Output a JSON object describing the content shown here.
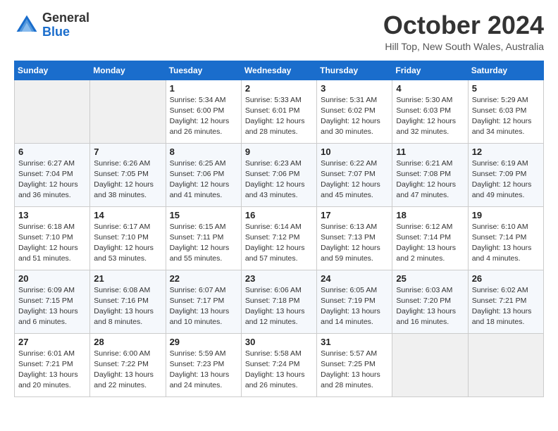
{
  "logo": {
    "general": "General",
    "blue": "Blue"
  },
  "title": "October 2024",
  "location": "Hill Top, New South Wales, Australia",
  "days_of_week": [
    "Sunday",
    "Monday",
    "Tuesday",
    "Wednesday",
    "Thursday",
    "Friday",
    "Saturday"
  ],
  "weeks": [
    [
      {
        "day": null
      },
      {
        "day": null
      },
      {
        "day": 1,
        "sunrise": "5:34 AM",
        "sunset": "6:00 PM",
        "daylight": "12 hours and 26 minutes"
      },
      {
        "day": 2,
        "sunrise": "5:33 AM",
        "sunset": "6:01 PM",
        "daylight": "12 hours and 28 minutes"
      },
      {
        "day": 3,
        "sunrise": "5:31 AM",
        "sunset": "6:02 PM",
        "daylight": "12 hours and 30 minutes"
      },
      {
        "day": 4,
        "sunrise": "5:30 AM",
        "sunset": "6:03 PM",
        "daylight": "12 hours and 32 minutes"
      },
      {
        "day": 5,
        "sunrise": "5:29 AM",
        "sunset": "6:03 PM",
        "daylight": "12 hours and 34 minutes"
      }
    ],
    [
      {
        "day": 6,
        "sunrise": "6:27 AM",
        "sunset": "7:04 PM",
        "daylight": "12 hours and 36 minutes"
      },
      {
        "day": 7,
        "sunrise": "6:26 AM",
        "sunset": "7:05 PM",
        "daylight": "12 hours and 38 minutes"
      },
      {
        "day": 8,
        "sunrise": "6:25 AM",
        "sunset": "7:06 PM",
        "daylight": "12 hours and 41 minutes"
      },
      {
        "day": 9,
        "sunrise": "6:23 AM",
        "sunset": "7:06 PM",
        "daylight": "12 hours and 43 minutes"
      },
      {
        "day": 10,
        "sunrise": "6:22 AM",
        "sunset": "7:07 PM",
        "daylight": "12 hours and 45 minutes"
      },
      {
        "day": 11,
        "sunrise": "6:21 AM",
        "sunset": "7:08 PM",
        "daylight": "12 hours and 47 minutes"
      },
      {
        "day": 12,
        "sunrise": "6:19 AM",
        "sunset": "7:09 PM",
        "daylight": "12 hours and 49 minutes"
      }
    ],
    [
      {
        "day": 13,
        "sunrise": "6:18 AM",
        "sunset": "7:10 PM",
        "daylight": "12 hours and 51 minutes"
      },
      {
        "day": 14,
        "sunrise": "6:17 AM",
        "sunset": "7:10 PM",
        "daylight": "12 hours and 53 minutes"
      },
      {
        "day": 15,
        "sunrise": "6:15 AM",
        "sunset": "7:11 PM",
        "daylight": "12 hours and 55 minutes"
      },
      {
        "day": 16,
        "sunrise": "6:14 AM",
        "sunset": "7:12 PM",
        "daylight": "12 hours and 57 minutes"
      },
      {
        "day": 17,
        "sunrise": "6:13 AM",
        "sunset": "7:13 PM",
        "daylight": "12 hours and 59 minutes"
      },
      {
        "day": 18,
        "sunrise": "6:12 AM",
        "sunset": "7:14 PM",
        "daylight": "13 hours and 2 minutes"
      },
      {
        "day": 19,
        "sunrise": "6:10 AM",
        "sunset": "7:14 PM",
        "daylight": "13 hours and 4 minutes"
      }
    ],
    [
      {
        "day": 20,
        "sunrise": "6:09 AM",
        "sunset": "7:15 PM",
        "daylight": "13 hours and 6 minutes"
      },
      {
        "day": 21,
        "sunrise": "6:08 AM",
        "sunset": "7:16 PM",
        "daylight": "13 hours and 8 minutes"
      },
      {
        "day": 22,
        "sunrise": "6:07 AM",
        "sunset": "7:17 PM",
        "daylight": "13 hours and 10 minutes"
      },
      {
        "day": 23,
        "sunrise": "6:06 AM",
        "sunset": "7:18 PM",
        "daylight": "13 hours and 12 minutes"
      },
      {
        "day": 24,
        "sunrise": "6:05 AM",
        "sunset": "7:19 PM",
        "daylight": "13 hours and 14 minutes"
      },
      {
        "day": 25,
        "sunrise": "6:03 AM",
        "sunset": "7:20 PM",
        "daylight": "13 hours and 16 minutes"
      },
      {
        "day": 26,
        "sunrise": "6:02 AM",
        "sunset": "7:21 PM",
        "daylight": "13 hours and 18 minutes"
      }
    ],
    [
      {
        "day": 27,
        "sunrise": "6:01 AM",
        "sunset": "7:21 PM",
        "daylight": "13 hours and 20 minutes"
      },
      {
        "day": 28,
        "sunrise": "6:00 AM",
        "sunset": "7:22 PM",
        "daylight": "13 hours and 22 minutes"
      },
      {
        "day": 29,
        "sunrise": "5:59 AM",
        "sunset": "7:23 PM",
        "daylight": "13 hours and 24 minutes"
      },
      {
        "day": 30,
        "sunrise": "5:58 AM",
        "sunset": "7:24 PM",
        "daylight": "13 hours and 26 minutes"
      },
      {
        "day": 31,
        "sunrise": "5:57 AM",
        "sunset": "7:25 PM",
        "daylight": "13 hours and 28 minutes"
      },
      {
        "day": null
      },
      {
        "day": null
      }
    ]
  ]
}
